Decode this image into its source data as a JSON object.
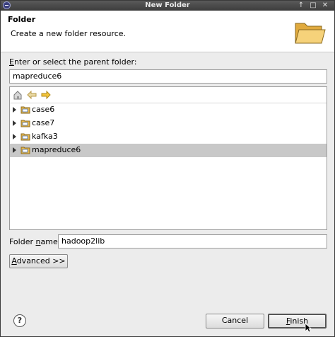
{
  "window": {
    "title": "New Folder",
    "btn_up": "↑",
    "btn_restore": "□",
    "btn_close": "✕"
  },
  "banner": {
    "title": "Folder",
    "description": "Create a new folder resource."
  },
  "parent": {
    "label_prefix": "E",
    "label_rest": "nter or select the parent folder:",
    "value": "mapreduce6"
  },
  "tree": {
    "items": [
      {
        "label": "case6",
        "selected": false
      },
      {
        "label": "case7",
        "selected": false
      },
      {
        "label": "kafka3",
        "selected": false
      },
      {
        "label": "mapreduce6",
        "selected": true
      }
    ]
  },
  "folder_name": {
    "label_pre": "Folder ",
    "label_u": "n",
    "label_post": "ame:",
    "value": "hadoop2lib"
  },
  "advanced": {
    "label_u": "A",
    "label_rest": "dvanced >>"
  },
  "footer": {
    "cancel": "Cancel",
    "finish_u": "F",
    "finish_rest": "inish"
  },
  "colors": {
    "selection": "#c8c8c8",
    "folder": "#e8b84a",
    "titlebar": "#4a4a4a"
  }
}
